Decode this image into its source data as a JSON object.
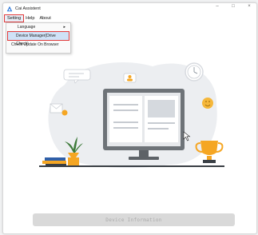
{
  "window": {
    "title": "Cai Assistent",
    "controls": [
      "–",
      "□",
      "×"
    ]
  },
  "menubar": {
    "items": [
      {
        "label": "Setting",
        "active": true
      },
      {
        "label": "Help"
      },
      {
        "label": "About"
      }
    ]
  },
  "dropdown": {
    "language_label": "Language",
    "language_arrow": "▸",
    "device_manager_label": "Device Manager(Drive Check)",
    "check_update_label": "Check Update On Browser"
  },
  "main": {
    "device_info_button": "Device Information"
  },
  "colors": {
    "highlight_border": "#e23a3a",
    "selection_bg": "#cfe2f7",
    "accent_orange": "#f5a623",
    "monitor_gray": "#6e7378"
  }
}
